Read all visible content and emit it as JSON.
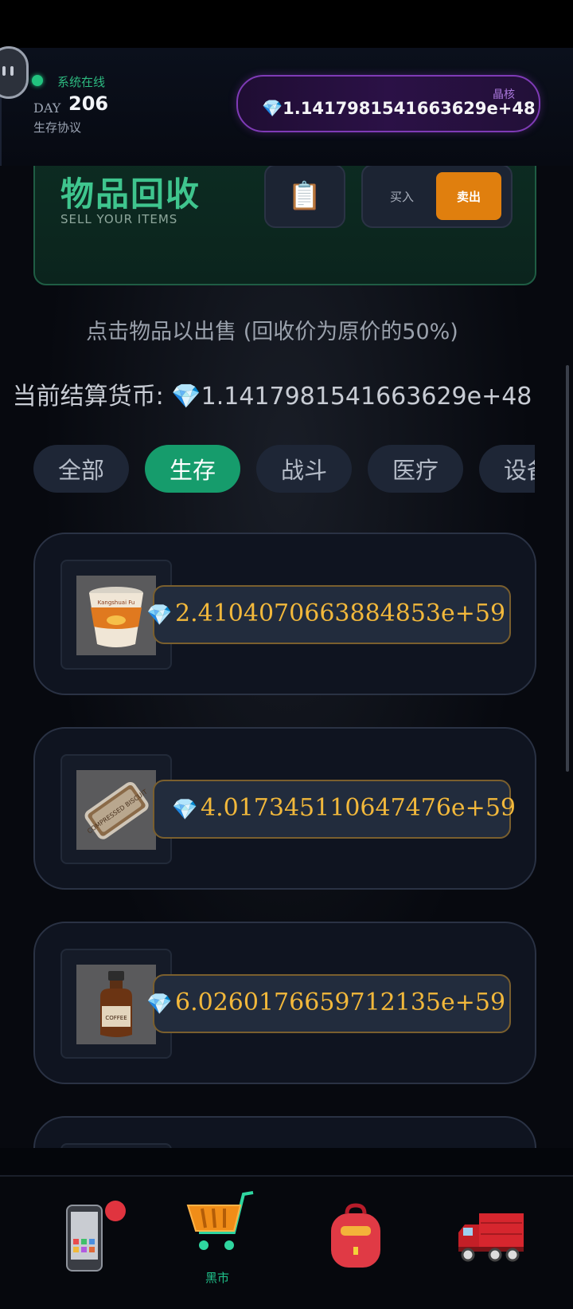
{
  "header": {
    "online_status": "系统在线",
    "day_label": "DAY",
    "day_value": "206",
    "protocol": "生存协议",
    "crystal_label": "晶核",
    "crystal_value": "💎1.1417981541663629e+48"
  },
  "hero": {
    "title": "物品回收",
    "subtitle": "SELL YOUR ITEMS",
    "clipboard_icon": "📋",
    "buy_label": "买入",
    "sell_label": "卖出",
    "active_mode": "sell"
  },
  "hint_text": "点击物品以出售 (回收价为原价的50%)",
  "balance_text": "当前结算货币: 💎1.1417981541663629e+48",
  "tabs": [
    {
      "label": "全部",
      "active": false
    },
    {
      "label": "生存",
      "active": true
    },
    {
      "label": "战斗",
      "active": false
    },
    {
      "label": "医疗",
      "active": false
    },
    {
      "label": "设备",
      "active": false
    }
  ],
  "items": [
    {
      "icon": "instant-noodles-cup",
      "label_on_image": "Kangshuai Fu",
      "gem": "💎",
      "price": "2.4104070663884853e+59"
    },
    {
      "icon": "compressed-biscuit",
      "label_on_image": "COMPRESSED BISCUIT",
      "gem": "💎",
      "price": "4.017345110647476e+59"
    },
    {
      "icon": "coffee-bottle",
      "label_on_image": "COFFEE",
      "gem": "💎",
      "price": "6.0260176659712135e+59"
    }
  ],
  "nav": [
    {
      "icon": "phone-icon",
      "label": "",
      "badge": true
    },
    {
      "icon": "shopping-cart-icon",
      "label": "黑市",
      "active": true
    },
    {
      "icon": "backpack-icon",
      "label": ""
    },
    {
      "icon": "truck-icon",
      "label": ""
    }
  ],
  "colors": {
    "accent_green": "#169c6c",
    "sell_orange": "#e07f0e",
    "price_gold": "#f2b83b",
    "crystal_purple": "#7f3bb6"
  }
}
